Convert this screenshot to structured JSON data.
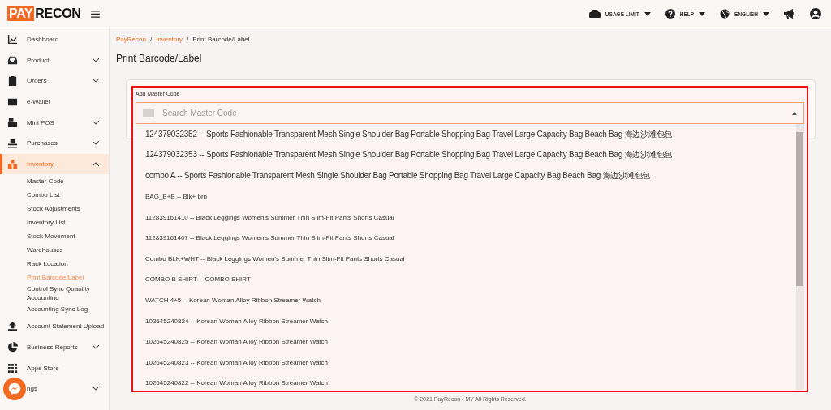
{
  "logo": {
    "part_1": "PAY",
    "part_2": "RECON"
  },
  "topbar": {
    "items": [
      {
        "kind": "usage",
        "label": "USAGE LIMIT"
      },
      {
        "kind": "help",
        "label": "HELP"
      },
      {
        "kind": "language",
        "label": "ENGLISH"
      }
    ]
  },
  "sidebar": {
    "items": [
      {
        "label": "Dashboard",
        "selected": false
      },
      {
        "label": "Product",
        "expanded": false,
        "selected": false
      },
      {
        "label": "Orders",
        "expanded": false,
        "selected": false
      },
      {
        "label": "e-Wallet",
        "selected": false
      },
      {
        "label": "Mini POS",
        "expanded": false,
        "selected": false
      },
      {
        "label": "Purchases",
        "expanded": false,
        "selected": false
      },
      {
        "label": "Inventory",
        "expanded": true,
        "selected": true,
        "children": [
          {
            "label": "Master Code",
            "selected": false
          },
          {
            "label": "Combo List",
            "selected": false
          },
          {
            "label": "Stock Adjustments",
            "selected": false
          },
          {
            "label": "Inventory List",
            "selected": false
          },
          {
            "label": "Stock Movement",
            "selected": false
          },
          {
            "label": "Warehouses",
            "selected": false
          },
          {
            "label": "Rack Location",
            "selected": false
          },
          {
            "label": "Print Barcode/Label",
            "selected": true
          },
          {
            "label": "Control Sync Quantity Accounting",
            "selected": false
          },
          {
            "label": "Accounting Sync Log",
            "selected": false
          }
        ]
      },
      {
        "label": "Account Statement Upload",
        "selected": false
      },
      {
        "label": "Business Reports",
        "expanded": false,
        "selected": false
      },
      {
        "label": "Apps Store",
        "selected": false
      },
      {
        "label": "ngs",
        "expanded": false,
        "selected": false
      }
    ]
  },
  "breadcrumb": [
    {
      "label": "PayRecon",
      "link": true
    },
    {
      "separator": "/",
      "label": "Inventory",
      "link": true
    },
    {
      "separator": "/",
      "label": "Print Barcode/Label",
      "link": false
    }
  ],
  "page_title": "Print Barcode/Label",
  "master_code": {
    "label": "Add Master Code",
    "placeholder": "Search Master Code",
    "expanded": true,
    "options": [
      "124379032352 -- Sports Fashionable Transparent Mesh Single Shoulder Bag Portable Shopping Bag Travel Large Capacity Bag Beach Bag 海边沙滩包包",
      "124379032353 -- Sports Fashionable Transparent Mesh Single Shoulder Bag Portable Shopping Bag Travel Large Capacity Bag Beach Bag 海边沙滩包包",
      "combo A -- Sports Fashionable Transparent Mesh Single Shoulder Bag Portable Shopping Bag Travel Large Capacity Bag Beach Bag 海边沙滩包包",
      "BAG_B+B -- Blk+ brn",
      "112839161410 -- Black Leggings Women's Summer Thin Slim-Fit Pants Shorts Casual",
      "112839161407 -- Black Leggings Women's Summer Thin Slim-Fit Pants Shorts Casual",
      "Combo BLK+WHT -- Black Leggings Women's Summer Thin Slim-Fit Pants Shorts Casual",
      "COMBO B SHIRT -- COMBO SHIRT",
      "WATCH 4+5 -- Korean Woman Alloy Ribbon Streamer Watch",
      "102645240824 -- Korean Woman Alloy Ribbon Streamer Watch",
      "102645240825 -- Korean Woman Alloy Ribbon Streamer Watch",
      "102645240823 -- Korean Woman Alloy Ribbon Streamer Watch",
      "102645240822 -- Korean Woman Alloy Ribbon Streamer Watch"
    ]
  },
  "footer": "© 2021 PayRecon - MY All Rights Reserved."
}
